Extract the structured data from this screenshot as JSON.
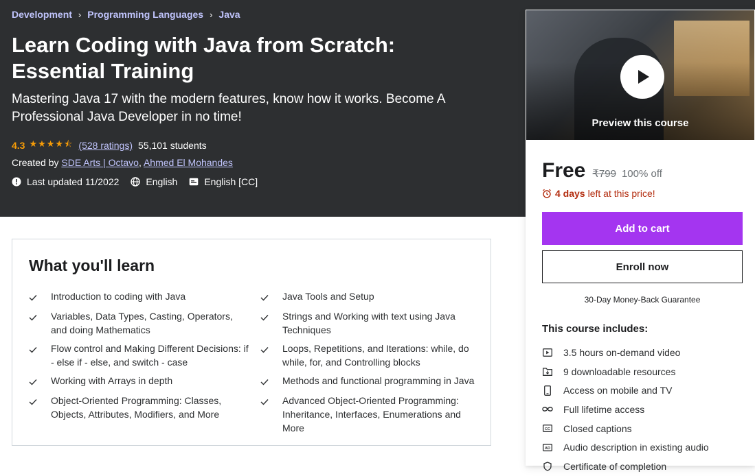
{
  "breadcrumb": [
    "Development",
    "Programming Languages",
    "Java"
  ],
  "course": {
    "title": "Learn Coding with Java from Scratch: Essential Training",
    "subtitle": "Mastering Java 17 with the modern features, know how it works. Become A Professional Java Developer in no time!",
    "rating": "4.3",
    "rating_value": 4.3,
    "ratings_count": "(528 ratings)",
    "students": "55,101 students",
    "created_by_label": "Created by",
    "authors": [
      "SDE Arts | Octavo",
      "Ahmed El Mohandes"
    ],
    "last_updated": "Last updated 11/2022",
    "language": "English",
    "captions": "English [CC]"
  },
  "sidebar": {
    "preview_label": "Preview this course",
    "price": "Free",
    "original_price": "₹799",
    "discount": "100% off",
    "timer_bold": "4 days",
    "timer_rest": "left at this price!",
    "add_to_cart": "Add to cart",
    "enroll_now": "Enroll now",
    "guarantee": "30-Day Money-Back Guarantee",
    "includes_title": "This course includes:",
    "includes": [
      {
        "icon": "video-icon",
        "label": "3.5 hours on-demand video"
      },
      {
        "icon": "download-icon",
        "label": "9 downloadable resources"
      },
      {
        "icon": "mobile-icon",
        "label": "Access on mobile and TV"
      },
      {
        "icon": "infinity-icon",
        "label": "Full lifetime access"
      },
      {
        "icon": "cc-icon",
        "label": "Closed captions"
      },
      {
        "icon": "audio-description-icon",
        "label": "Audio description in existing audio"
      },
      {
        "icon": "certificate-icon",
        "label": "Certificate of completion"
      }
    ]
  },
  "learn": {
    "title": "What you'll learn",
    "items": [
      "Introduction to coding with Java",
      "Java Tools and Setup",
      "Variables, Data Types, Casting, Operators, and doing Mathematics",
      "Strings and Working with text using Java Techniques",
      "Flow control and Making Different Decisions: if - else if - else, and switch - case",
      "Loops, Repetitions, and Iterations: while, do while, for, and Controlling blocks",
      "Working with Arrays in depth",
      "Methods and functional programming in Java",
      "Object-Oriented Programming: Classes, Objects, Attributes, Modifiers, and More",
      "Advanced Object-Oriented Programming: Inheritance, Interfaces, Enumerations and More"
    ]
  },
  "colors": {
    "hero_bg": "#2d2f31",
    "link_purple": "#c0c4fc",
    "star": "#f69c08",
    "cart_button": "#a435f0",
    "timer_red": "#b32d0f"
  }
}
